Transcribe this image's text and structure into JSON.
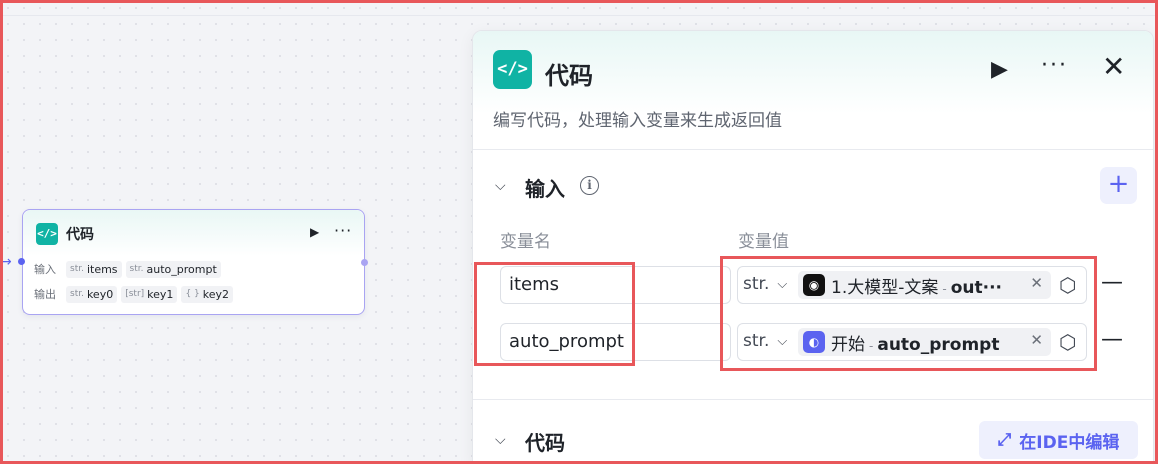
{
  "canvas_node": {
    "icon": "</>",
    "title": "代码",
    "input_label": "输入",
    "output_label": "输出",
    "inputs": [
      {
        "type": "str.",
        "name": "items"
      },
      {
        "type": "str.",
        "name": "auto_prompt"
      }
    ],
    "outputs": [
      {
        "type": "str.",
        "name": "key0"
      },
      {
        "type": "[str]",
        "name": "key1"
      },
      {
        "type": "{ }",
        "name": "key2"
      }
    ]
  },
  "panel": {
    "icon": "</>",
    "title": "代码",
    "description": "编写代码，处理输入变量来生成返回值",
    "input_section": {
      "title": "输入",
      "col_name": "变量名",
      "col_value": "变量值",
      "rows": [
        {
          "name": "items",
          "type": "str.",
          "ref_icon": "llm-icon",
          "ref_source": "1.大模型-文案",
          "ref_sep": "-",
          "ref_field": "out···"
        },
        {
          "name": "auto_prompt",
          "type": "str.",
          "ref_icon": "start-icon",
          "ref_source": "开始",
          "ref_sep": "-",
          "ref_field": "auto_prompt"
        }
      ]
    },
    "code_section": {
      "title": "代码",
      "ide_button": "在IDE中编辑"
    }
  },
  "colors": {
    "accent": "#5b63f0",
    "code_icon": "#10b3a4",
    "highlight": "#e8575a"
  }
}
